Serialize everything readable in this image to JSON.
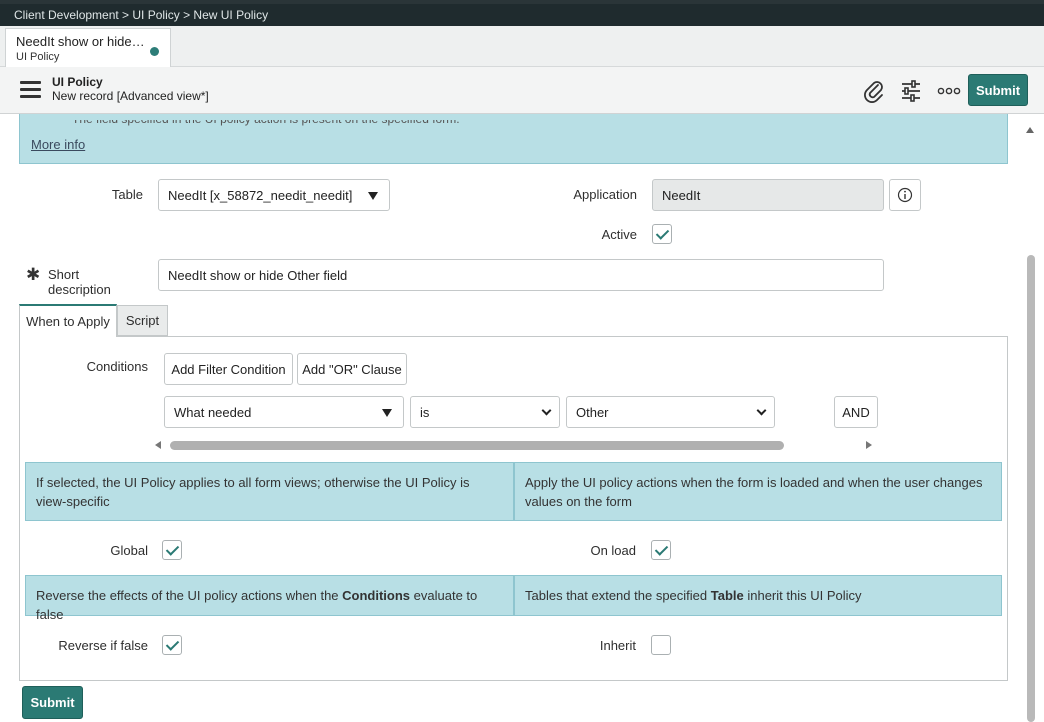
{
  "breadcrumb": "Client Development > UI Policy > New UI Policy",
  "doc_tab": {
    "title": "NeedIt show or hide…",
    "subtitle": "UI Policy"
  },
  "header": {
    "title": "UI Policy",
    "subtitle": "New record [Advanced view*]",
    "submit_label": "Submit"
  },
  "top_info": {
    "cut_text": "The field specified in the UI policy action is present on the specified form.",
    "more_info": "More info"
  },
  "form": {
    "table_label": "Table",
    "table_value": "NeedIt [x_58872_needit_needit]",
    "application_label": "Application",
    "application_value": "NeedIt",
    "active_label": "Active",
    "active_checked": true,
    "short_description_label": "Short description",
    "short_description_value": "NeedIt show or hide Other field"
  },
  "tabs": [
    {
      "label": "When to Apply",
      "active": true
    },
    {
      "label": "Script",
      "active": false
    }
  ],
  "conditions": {
    "label": "Conditions",
    "add_filter_label": "Add Filter Condition",
    "add_or_label": "Add \"OR\" Clause",
    "field_value": "What needed",
    "operator_value": "is",
    "value_value": "Other",
    "and_label": "AND"
  },
  "help": {
    "global": "If selected, the UI Policy applies to all form views; otherwise the UI Policy is view-specific",
    "on_load": "Apply the UI policy actions when the form is loaded and when the user changes values on the form",
    "reverse_pre": "Reverse the effects of the UI policy actions when the ",
    "reverse_bold": "Conditions",
    "reverse_post": " evaluate to false",
    "inherit_pre": "Tables that extend the specified ",
    "inherit_bold": "Table",
    "inherit_post": " inherit this UI Policy"
  },
  "options": {
    "global_label": "Global",
    "global_checked": true,
    "on_load_label": "On load",
    "on_load_checked": true,
    "reverse_label": "Reverse if false",
    "reverse_checked": true,
    "inherit_label": "Inherit",
    "inherit_checked": false
  },
  "footer": {
    "submit_label": "Submit"
  },
  "colors": {
    "accent": "#2b7a74",
    "info_bg": "#b8dfe5",
    "topbar": "#1f2b2e"
  }
}
